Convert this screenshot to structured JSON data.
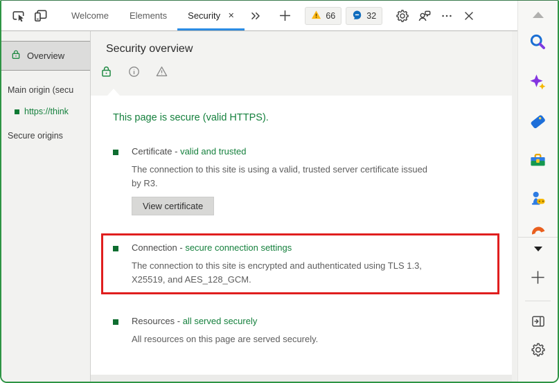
{
  "toolbar": {
    "tabs": [
      {
        "label": "Welcome"
      },
      {
        "label": "Elements"
      },
      {
        "label": "Security"
      }
    ],
    "active_tab": "Security",
    "issues_count": "66",
    "messages_count": "32",
    "glyphs": {
      "close_tab": "✕"
    }
  },
  "sidebar": {
    "overview": "Overview",
    "main_origin_label": "Main origin (secu",
    "origin_link": "https://think",
    "secure_origins_label": "Secure origins"
  },
  "panel": {
    "title": "Security overview",
    "summary": "This page is secure (valid HTTPS).",
    "sections": [
      {
        "prefix": "Certificate - ",
        "link": "valid and trusted",
        "desc_line1": "The connection to this site is using a valid, trusted server certificate issued",
        "desc_line2": "by R3.",
        "button_label": "View certificate"
      },
      {
        "prefix": "Connection - ",
        "link": "secure connection settings",
        "desc_line1": "The connection to this site is encrypted and authenticated using TLS 1.3,",
        "desc_line2": "X25519, and AES_128_GCM."
      },
      {
        "prefix": "Resources - ",
        "link": "all served securely",
        "desc_line1": "All resources on this page are served securely.",
        "desc_line2": ""
      }
    ]
  },
  "edge_sidebar": {
    "icons": [
      "scroll-up",
      "search",
      "copilot-sparkle",
      "shopping-tag",
      "tools",
      "games",
      "microsoft-365",
      "collapse-chevron",
      "add",
      "enter-sidebar",
      "settings"
    ]
  },
  "colors": {
    "secure_green": "#15803d",
    "highlight_red": "#e01e1e",
    "active_tab_blue": "#2b8ce3",
    "warning_amber": "#fcb714",
    "message_blue": "#0f6cbd",
    "window_border_green": "#2e9444"
  }
}
